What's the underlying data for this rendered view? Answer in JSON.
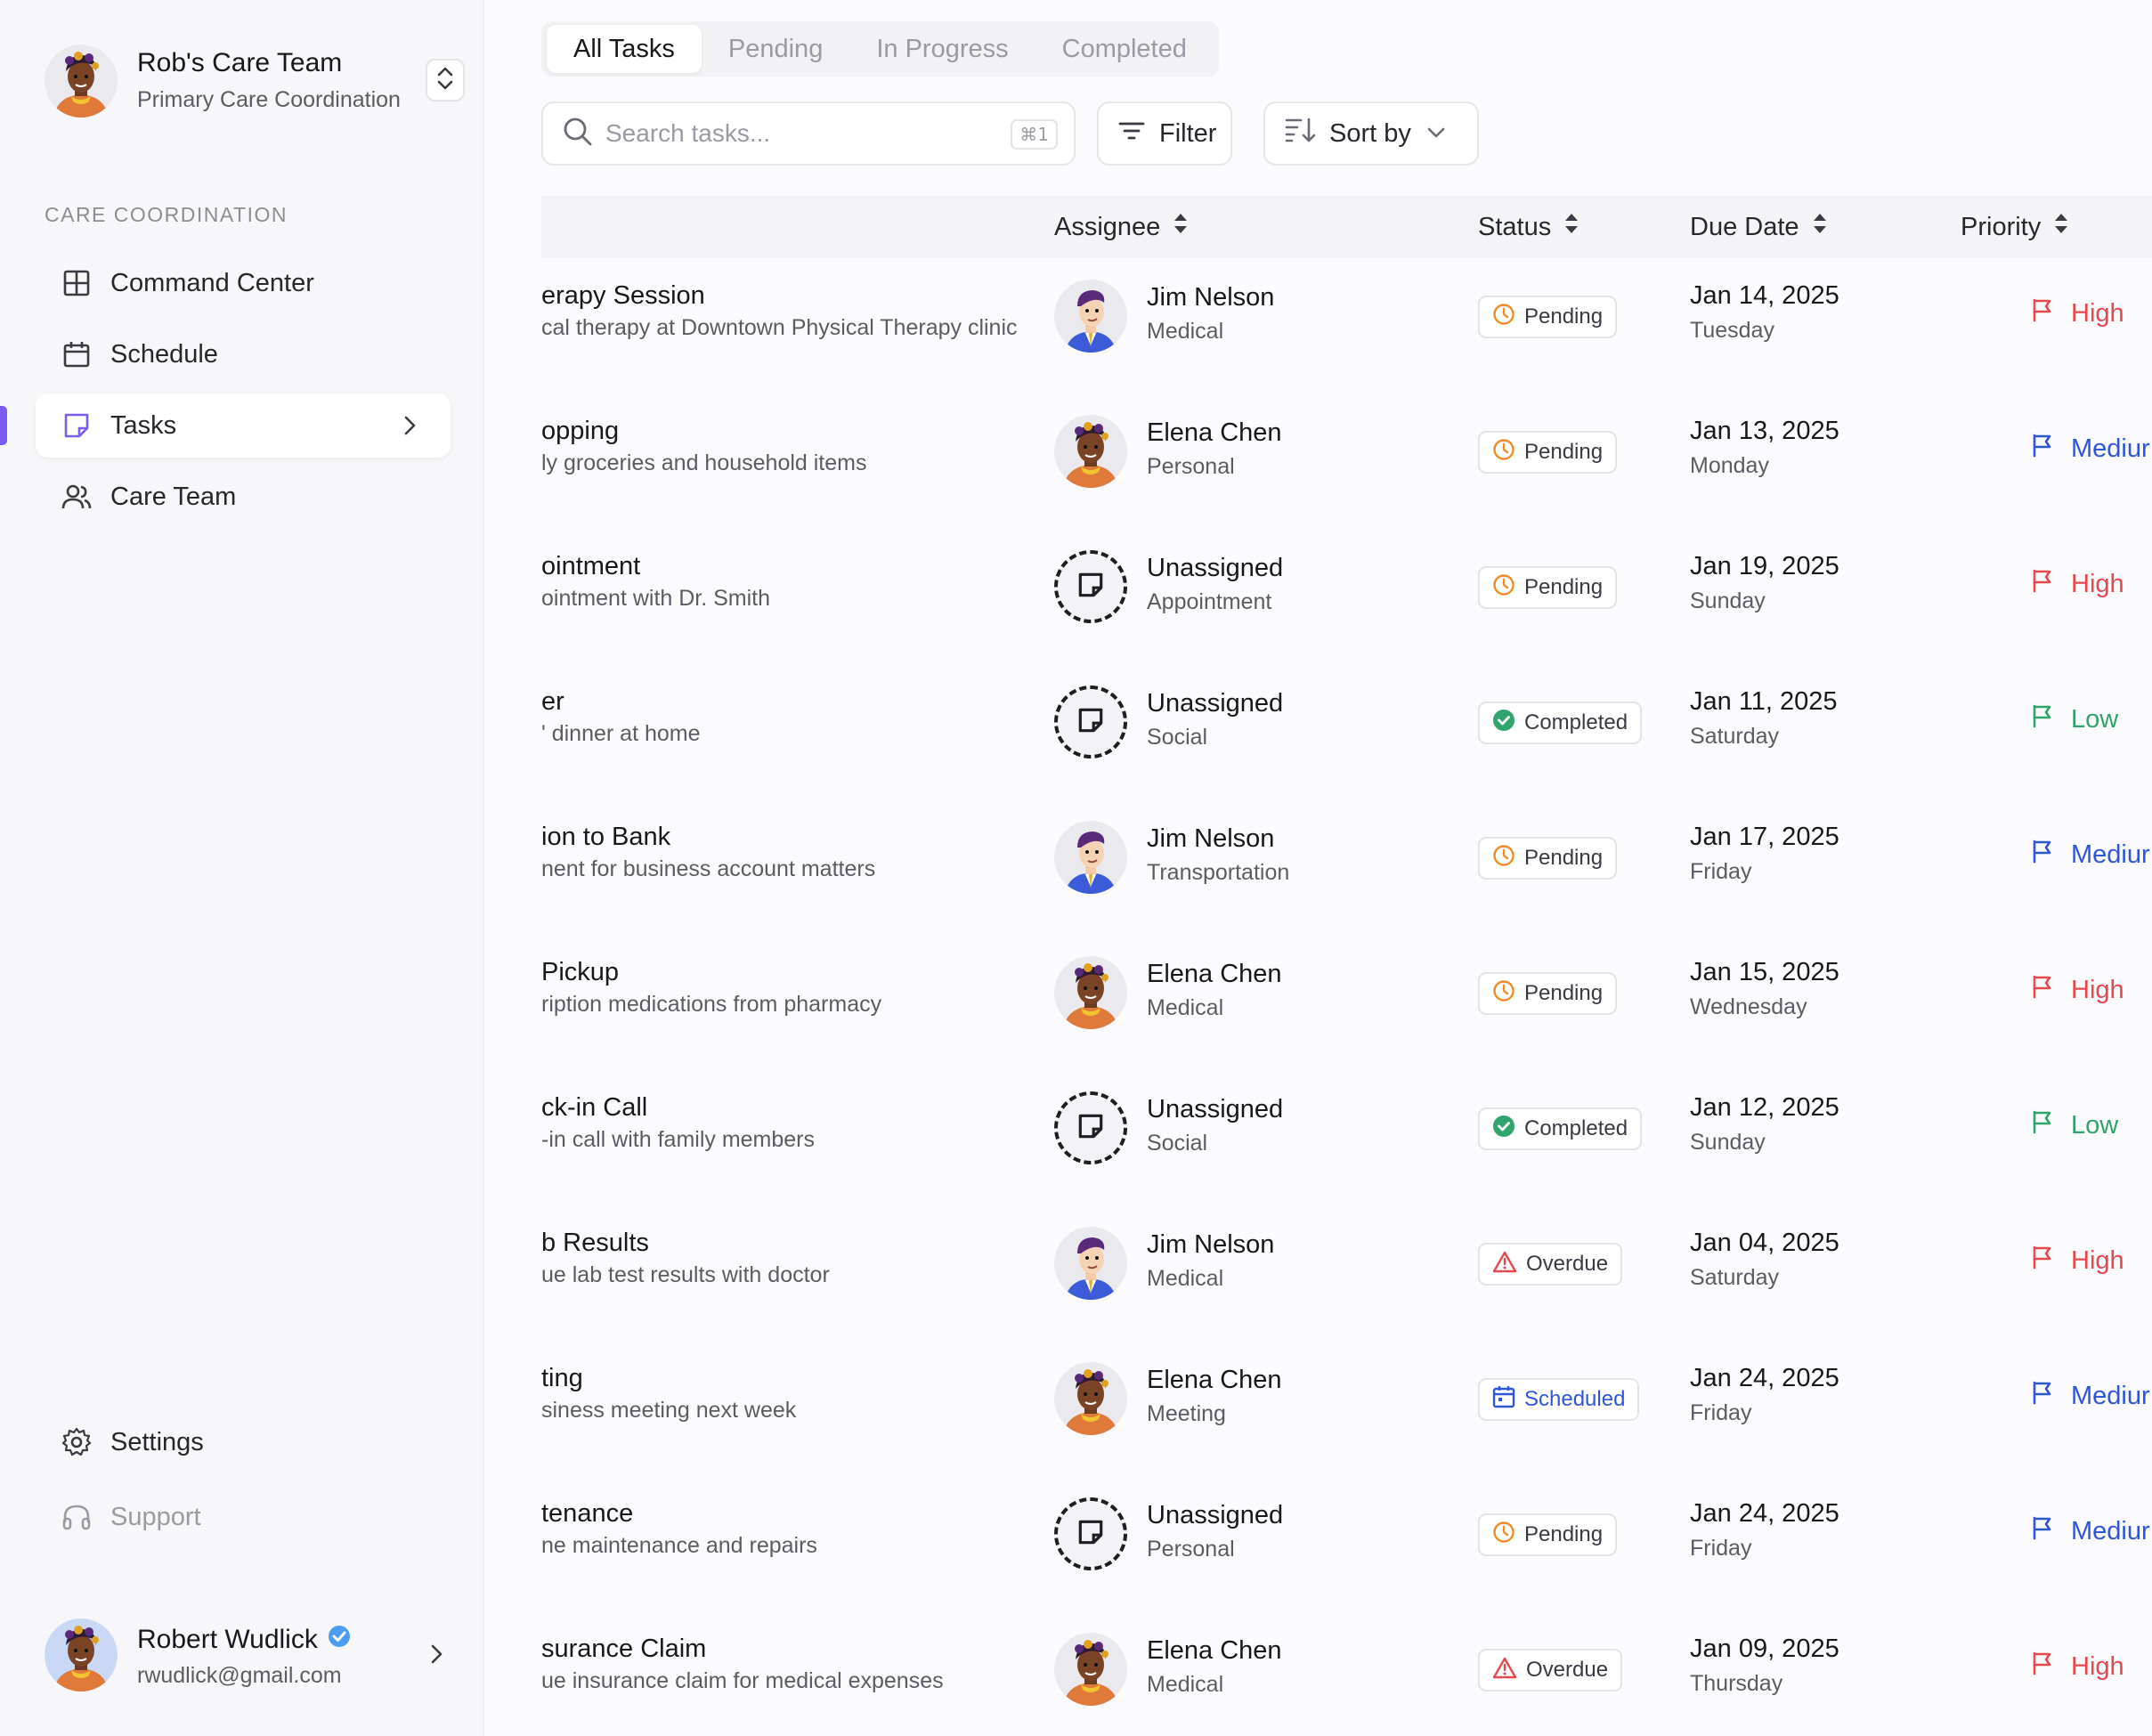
{
  "sidebar": {
    "team_name": "Rob's Care Team",
    "team_subtitle": "Primary Care Coordination",
    "section_label": "CARE COORDINATION",
    "nav": [
      {
        "label": "Command Center",
        "icon": "grid-icon"
      },
      {
        "label": "Schedule",
        "icon": "calendar-icon"
      },
      {
        "label": "Tasks",
        "icon": "note-icon",
        "active": true
      },
      {
        "label": "Care Team",
        "icon": "users-icon"
      }
    ],
    "settings_label": "Settings",
    "support_label": "Support",
    "user": {
      "name": "Robert Wudlick",
      "email": "rwudlick@gmail.com",
      "verified": true
    }
  },
  "tabs": [
    "All Tasks",
    "Pending",
    "In Progress",
    "Completed"
  ],
  "search": {
    "placeholder": "Search tasks...",
    "shortcut": "⌘1"
  },
  "toolbar": {
    "filter_label": "Filter",
    "sort_label": "Sort by"
  },
  "columns": {
    "assignee": "Assignee",
    "status": "Status",
    "due_date": "Due Date",
    "priority": "Priority"
  },
  "colors": {
    "accent": "#7b5cf0",
    "high": "#e5484d",
    "medium": "#2e56d9",
    "low": "#30a46c",
    "pending": "#f08a24",
    "completed": "#30a46c",
    "overdue": "#e5484d",
    "scheduled": "#2e56d9"
  },
  "rows": [
    {
      "title": "erapy Session",
      "desc": "cal therapy at Downtown Physical Therapy clinic",
      "assignee": "Jim Nelson",
      "category": "Medical",
      "status": "Pending",
      "date": "Jan 14, 2025",
      "day": "Tuesday",
      "priority": "High"
    },
    {
      "title": "opping",
      "desc": "ly groceries and household items",
      "assignee": "Elena Chen",
      "category": "Personal",
      "status": "Pending",
      "date": "Jan 13, 2025",
      "day": "Monday",
      "priority": "Mediur"
    },
    {
      "title": "ointment",
      "desc": "ointment with Dr. Smith",
      "assignee": "Unassigned",
      "category": "Appointment",
      "status": "Pending",
      "date": "Jan 19, 2025",
      "day": "Sunday",
      "priority": "High"
    },
    {
      "title": "er",
      "desc": "' dinner at home",
      "assignee": "Unassigned",
      "category": "Social",
      "status": "Completed",
      "date": "Jan 11, 2025",
      "day": "Saturday",
      "priority": "Low"
    },
    {
      "title": "ion to Bank",
      "desc": "nent for business account matters",
      "assignee": "Jim Nelson",
      "category": "Transportation",
      "status": "Pending",
      "date": "Jan 17, 2025",
      "day": "Friday",
      "priority": "Mediur"
    },
    {
      "title": "Pickup",
      "desc": "ription medications from pharmacy",
      "assignee": "Elena Chen",
      "category": "Medical",
      "status": "Pending",
      "date": "Jan 15, 2025",
      "day": "Wednesday",
      "priority": "High"
    },
    {
      "title": "ck-in Call",
      "desc": "-in call with family members",
      "assignee": "Unassigned",
      "category": "Social",
      "status": "Completed",
      "date": "Jan 12, 2025",
      "day": "Sunday",
      "priority": "Low"
    },
    {
      "title": "b Results",
      "desc": "ue lab test results with doctor",
      "assignee": "Jim Nelson",
      "category": "Medical",
      "status": "Overdue",
      "date": "Jan 04, 2025",
      "day": "Saturday",
      "priority": "High"
    },
    {
      "title": "ting",
      "desc": "siness meeting next week",
      "assignee": "Elena Chen",
      "category": "Meeting",
      "status": "Scheduled",
      "date": "Jan 24, 2025",
      "day": "Friday",
      "priority": "Mediur"
    },
    {
      "title": "tenance",
      "desc": "ne maintenance and repairs",
      "assignee": "Unassigned",
      "category": "Personal",
      "status": "Pending",
      "date": "Jan 24, 2025",
      "day": "Friday",
      "priority": "Mediur"
    },
    {
      "title": "surance Claim",
      "desc": "ue insurance claim for medical expenses",
      "assignee": "Elena Chen",
      "category": "Medical",
      "status": "Overdue",
      "date": "Jan 09, 2025",
      "day": "Thursday",
      "priority": "High"
    }
  ]
}
